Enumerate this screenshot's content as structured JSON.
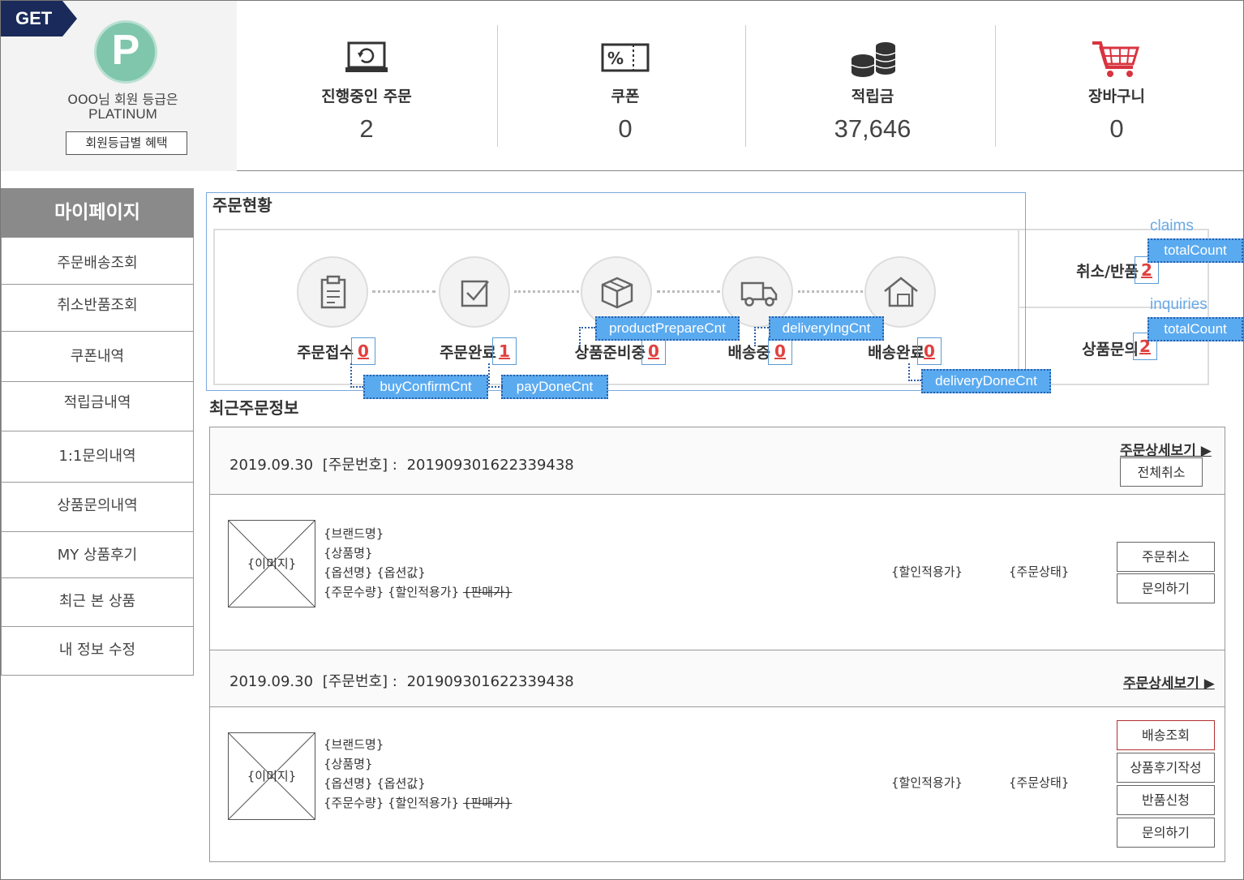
{
  "badge": "GET",
  "grade": {
    "icon_letter": "P",
    "line": "OOO님 회원 등급은",
    "name": "PLATINUM",
    "benefit_button": "회원등급별 혜택"
  },
  "stats": [
    {
      "icon": "laptop-refresh-icon",
      "label": "진행중인 주문",
      "value": "2"
    },
    {
      "icon": "coupon-ticket-icon",
      "label": "쿠폰",
      "value": "0"
    },
    {
      "icon": "coins-icon",
      "label": "적립금",
      "value": "37,646"
    },
    {
      "icon": "shopping-cart-icon",
      "label": "장바구니",
      "value": "0"
    }
  ],
  "sidebar": {
    "title": "마이페이지",
    "items": [
      {
        "label": "주문배송조회"
      },
      {
        "label": "취소반품조회"
      },
      {
        "label": "쿠폰내역"
      },
      {
        "label": "적립금내역"
      },
      {
        "label": "1:1문의내역"
      },
      {
        "label": "상품문의내역"
      },
      {
        "label": "MY 상품후기"
      },
      {
        "label": "최근 본 상품"
      },
      {
        "label": "내 정보 수정"
      }
    ]
  },
  "order_status": {
    "title": "주문현황",
    "steps": [
      {
        "icon": "clipboard-icon",
        "label": "주문접수",
        "count": "0",
        "tag": "buyConfirmCnt"
      },
      {
        "icon": "checkbox-icon",
        "label": "주문완료",
        "count": "1",
        "tag": "payDoneCnt"
      },
      {
        "icon": "box-icon",
        "label": "상품준비중",
        "count": "0",
        "tag": "productPrepareCnt"
      },
      {
        "icon": "truck-icon",
        "label": "배송중",
        "count": "0",
        "tag": "deliveryIngCnt"
      },
      {
        "icon": "home-box-icon",
        "label": "배송완료",
        "count": "0",
        "tag": "deliveryDoneCnt"
      }
    ],
    "claims": {
      "caption": "claims",
      "label": "취소/반품",
      "count": "2",
      "tag": "totalCount"
    },
    "inquiries": {
      "caption": "inquiries",
      "label": "상품문의",
      "count": "2",
      "tag": "totalCount"
    }
  },
  "recent": {
    "title": "최근주문정보",
    "orders": [
      {
        "date": "2019.09.30",
        "order_no_label": "[주문번호] :",
        "order_no": "201909301622339438",
        "detail_link": "주문상세보기 ▶",
        "head_button": "전체취소",
        "image_label": "{이미지}",
        "brand": "{브랜드명}",
        "product": "{상품명}",
        "option": "{옵션명} {옵션값}",
        "qty_price": "{주문수량} {할인적용가}",
        "orig_price": "{판매가}",
        "discount_price": "{할인적용가}",
        "status": "{주문상태}",
        "buttons": [
          "주문취소",
          "문의하기"
        ]
      },
      {
        "date": "2019.09.30",
        "order_no_label": "[주문번호] :",
        "order_no": "201909301622339438",
        "detail_link": "주문상세보기 ▶",
        "image_label": "{이미지}",
        "brand": "{브랜드명}",
        "product": "{상품명}",
        "option": "{옵션명} {옵션값}",
        "qty_price": "{주문수량} {할인적용가}",
        "orig_price": "{판매가}",
        "discount_price": "{할인적용가}",
        "status": "{주문상태}",
        "buttons": [
          "배송조회",
          "상품후기작성",
          "반품신청",
          "문의하기"
        ]
      }
    ]
  },
  "colors": {
    "badge": "#1a2a5a",
    "grade_circle": "#7fc6ad",
    "tag": "#5aaaf0",
    "count": "#e04040",
    "cart": "#d8343f"
  }
}
